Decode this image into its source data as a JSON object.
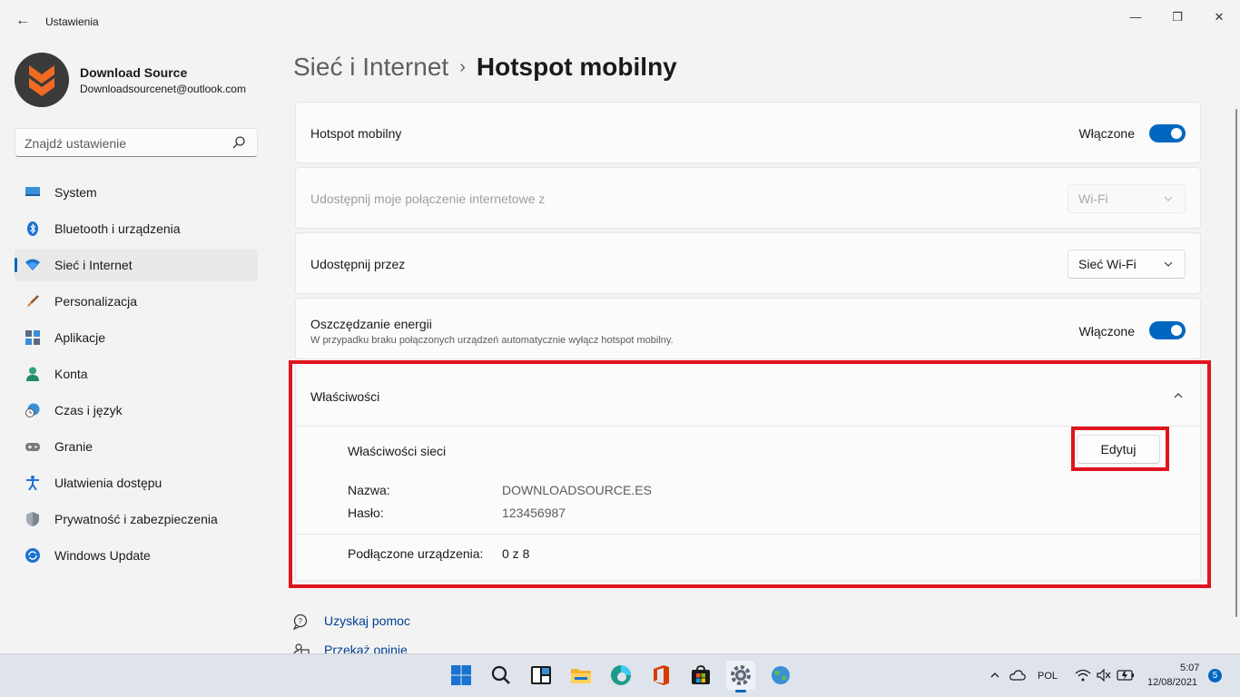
{
  "window": {
    "app_title": "Ustawienia",
    "back_glyph": "←",
    "minimize_glyph": "—",
    "maximize_glyph": "❐",
    "close_glyph": "✕"
  },
  "profile": {
    "name": "Download Source",
    "email": "Downloadsourcenet@outlook.com"
  },
  "search": {
    "placeholder": "Znajdź ustawienie"
  },
  "sidebar": {
    "items": [
      {
        "label": "System",
        "icon": "monitor-icon"
      },
      {
        "label": "Bluetooth i urządzenia",
        "icon": "bluetooth-icon"
      },
      {
        "label": "Sieć i Internet",
        "icon": "wifi-icon",
        "active": true
      },
      {
        "label": "Personalizacja",
        "icon": "brush-icon"
      },
      {
        "label": "Aplikacje",
        "icon": "apps-icon"
      },
      {
        "label": "Konta",
        "icon": "person-icon"
      },
      {
        "label": "Czas i język",
        "icon": "clock-globe-icon"
      },
      {
        "label": "Granie",
        "icon": "gamepad-icon"
      },
      {
        "label": "Ułatwienia dostępu",
        "icon": "accessibility-icon"
      },
      {
        "label": "Prywatność i zabezpieczenia",
        "icon": "shield-icon"
      },
      {
        "label": "Windows Update",
        "icon": "update-icon"
      }
    ]
  },
  "breadcrumb": {
    "parent": "Sieć i Internet",
    "separator": "›",
    "current": "Hotspot mobilny"
  },
  "settings": {
    "hotspot": {
      "label": "Hotspot mobilny",
      "state": "Włączone",
      "on": true
    },
    "share_from": {
      "label": "Udostępnij moje połączenie internetowe z",
      "value": "Wi-Fi",
      "disabled": true
    },
    "share_over": {
      "label": "Udostępnij przez",
      "value": "Sieć Wi-Fi"
    },
    "power_saving": {
      "label": "Oszczędzanie energii",
      "description": "W przypadku braku połączonych urządzeń automatycznie wyłącz hotspot mobilny.",
      "state": "Włączone",
      "on": true
    },
    "properties": {
      "header": "Właściwości",
      "network_props_label": "Właściwości sieci",
      "edit_button": "Edytuj",
      "name_label": "Nazwa:",
      "name_value": "DOWNLOADSOURCE.ES",
      "password_label": "Hasło:",
      "password_value": "123456987",
      "connected_label": "Podłączone urządzenia:",
      "connected_value": "0 z 8"
    }
  },
  "help": {
    "get_help": "Uzyskaj pomoc",
    "feedback": "Przekaż opinię"
  },
  "taskbar": {
    "tray_lang": "POL",
    "time": "5:07",
    "date": "12/08/2021",
    "notification_count": "5"
  },
  "colors": {
    "accent": "#0067c0",
    "highlight_red": "#e0141e",
    "background": "#f3f3f3"
  }
}
